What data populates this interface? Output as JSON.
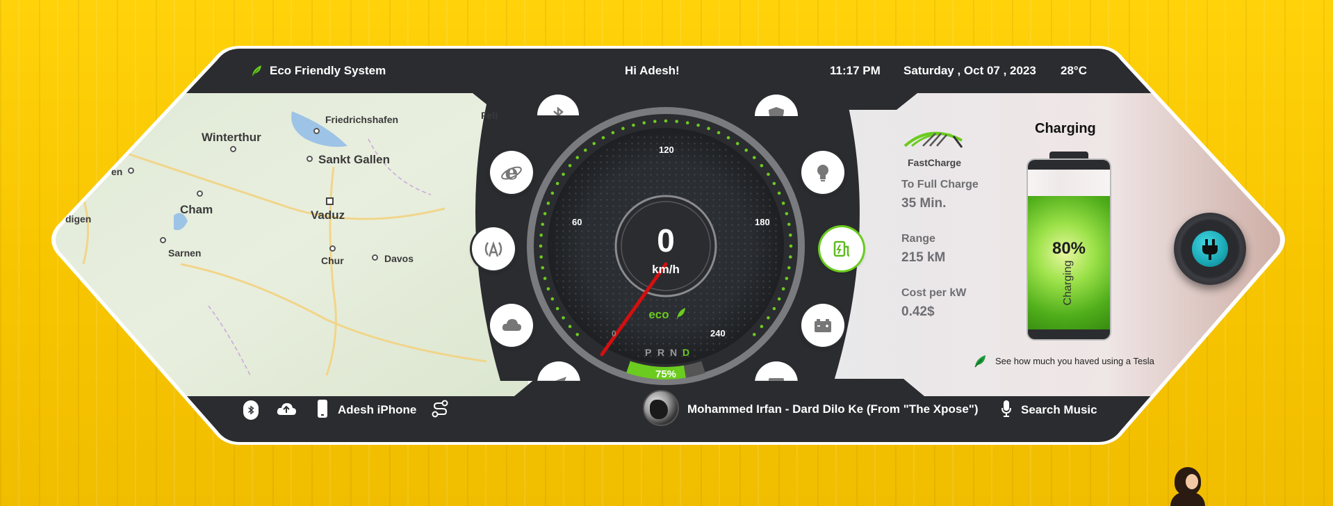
{
  "header": {
    "eco_label": "Eco Friendly System",
    "greeting": "Hi Adesh!",
    "time": "11:17 PM",
    "date": "Saturday , Oct 07 , 2023",
    "temperature": "28°C"
  },
  "map": {
    "labels": [
      "Friedrichshafen",
      "Winterthur",
      "Sankt Gallen",
      "Cham",
      "Vaduz",
      "Sarnen",
      "Chur",
      "Davos",
      "digen",
      "en",
      "Feli"
    ]
  },
  "speedometer": {
    "speed": "0",
    "unit": "km/h",
    "ticks": [
      "60",
      "120",
      "180",
      "240",
      "0"
    ],
    "mode": "eco",
    "gears": [
      "P",
      "R",
      "N",
      "D"
    ],
    "active_gear": "D",
    "battery_percent": "75%",
    "battery_level": 0.75
  },
  "left_buttons": [
    "bluetooth-icon",
    "browser-e-icon",
    "radio-antenna-icon",
    "cloud-icon",
    "navigation-icon"
  ],
  "right_buttons": [
    "shield-icon",
    "bulb-icon",
    "ev-charger-icon",
    "car-battery-icon",
    "more-icon"
  ],
  "charging": {
    "brand": "FastCharge",
    "title": "Charging",
    "to_full_label": "To Full Charge",
    "to_full_value": "35 Min.",
    "range_label": "Range",
    "range_value": "215 kM",
    "cost_label": "Cost per kW",
    "cost_value": "0.42$",
    "percent": "80%",
    "level": 0.8,
    "vertical_label": "Charging",
    "tesla_link": "See how much you haved using a Tesla"
  },
  "footer": {
    "device": "Adesh iPhone",
    "song": "Mohammed Irfan - Dard Dilo Ke (From \"The Xpose\")",
    "search_music": "Search Music"
  },
  "colors": {
    "accent_green": "#6bcb1f",
    "dash_dark": "#2b2c30",
    "needle": "#d40f0f",
    "plug_button": "#1aa8b5"
  }
}
